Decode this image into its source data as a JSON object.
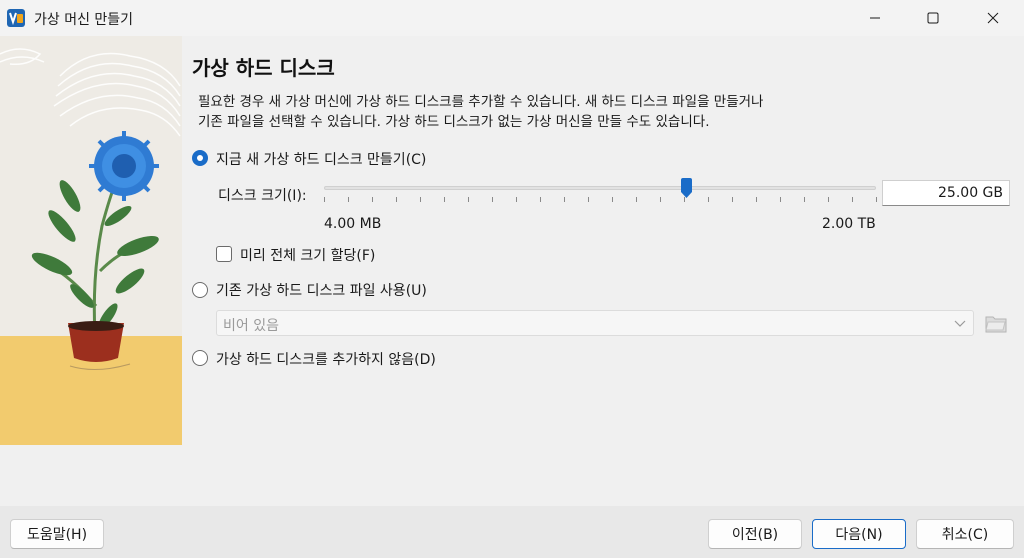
{
  "window": {
    "title": "가상 머신 만들기",
    "controls": {
      "minimize": "minimize-icon",
      "maximize": "maximize-icon",
      "close": "close-icon"
    }
  },
  "page": {
    "heading": "가상 하드 디스크",
    "description_line1": "필요한 경우 새 가상 머신에 가상 하드 디스크를 추가할 수 있습니다. 새 하드 디스크 파일을 만들거나",
    "description_line2": "기존 파일을 선택할 수 있습니다. 가상 하드 디스크가 없는 가상 머신을 만들 수도 있습니다."
  },
  "options": {
    "create_new": {
      "label": "지금 새 가상 하드 디스크 만들기(C)",
      "selected": true
    },
    "disk_size": {
      "label": "디스크 크기(I):",
      "value": "25.00 GB",
      "min_label": "4.00 MB",
      "max_label": "2.00 TB",
      "slider_fraction": 0.657
    },
    "preallocate": {
      "label": "미리 전체 크기 할당(F)",
      "checked": false
    },
    "use_existing": {
      "label": "기존 가상 하드 디스크 파일 사용(U)",
      "selected": false,
      "select_value": "비어 있음"
    },
    "no_disk": {
      "label": "가상 하드 디스크를 추가하지 않음(D)",
      "selected": false
    }
  },
  "footer": {
    "help": "도움말(H)",
    "back": "이전(B)",
    "next": "다음(N)",
    "cancel": "취소(C)"
  },
  "colors": {
    "accent": "#1a6cc8",
    "sand": "#f2cb6e",
    "flower": "#2f7bd3",
    "leaf": "#3f7a3b",
    "pot": "#9c2f1e"
  }
}
